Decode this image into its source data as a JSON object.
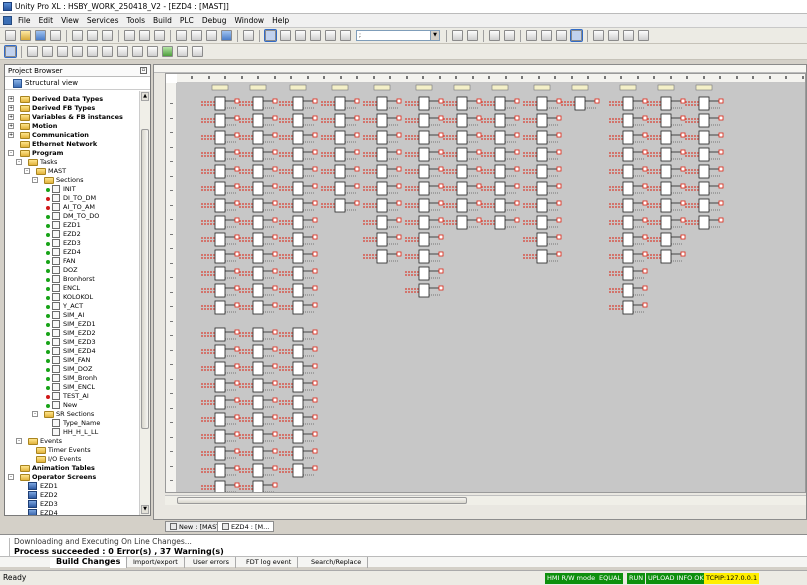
{
  "window": {
    "title": "Unity Pro XL : HSBY_WORK_250418_V2 - [EZD4 : [MAST]]"
  },
  "menu": [
    "File",
    "Edit",
    "View",
    "Services",
    "Tools",
    "Build",
    "PLC",
    "Debug",
    "Window",
    "Help"
  ],
  "toolbar": {
    "combo_value": ";"
  },
  "project_browser": {
    "title": "Project Browser",
    "view_label": "Structural view",
    "items": [
      {
        "label": "Derived Data Types",
        "level": 1,
        "kind": "folder",
        "bold": true,
        "exp": "+"
      },
      {
        "label": "Derived FB Types",
        "level": 1,
        "kind": "folder",
        "bold": true,
        "exp": "+"
      },
      {
        "label": "Variables & FB instances",
        "level": 1,
        "kind": "folder",
        "bold": true,
        "exp": "+"
      },
      {
        "label": "Motion",
        "level": 1,
        "kind": "folder",
        "bold": true,
        "exp": "+"
      },
      {
        "label": "Communication",
        "level": 1,
        "kind": "folder",
        "bold": true,
        "exp": "+"
      },
      {
        "label": "Ethernet Network",
        "level": 1,
        "kind": "folder",
        "bold": true,
        "exp": ""
      },
      {
        "label": "Program",
        "level": 1,
        "kind": "folder",
        "bold": true,
        "exp": "-"
      },
      {
        "label": "Tasks",
        "level": 2,
        "kind": "folder",
        "bold": false,
        "exp": "-"
      },
      {
        "label": "MAST",
        "level": 3,
        "kind": "folder",
        "bold": false,
        "exp": "-"
      },
      {
        "label": "Sections",
        "level": 4,
        "kind": "folder",
        "bold": false,
        "exp": "-"
      },
      {
        "label": "INIT",
        "level": 5,
        "kind": "section",
        "status": "green"
      },
      {
        "label": "DI_TO_DM",
        "level": 5,
        "kind": "section",
        "status": "red"
      },
      {
        "label": "AI_TO_AM",
        "level": 5,
        "kind": "section",
        "status": "red"
      },
      {
        "label": "DM_TO_DO",
        "level": 5,
        "kind": "section",
        "status": "green"
      },
      {
        "label": "EZD1",
        "level": 5,
        "kind": "section",
        "status": "green"
      },
      {
        "label": "EZD2",
        "level": 5,
        "kind": "section",
        "status": "green"
      },
      {
        "label": "EZD3",
        "level": 5,
        "kind": "section",
        "status": "green"
      },
      {
        "label": "EZD4",
        "level": 5,
        "kind": "section",
        "status": "green"
      },
      {
        "label": "FAN",
        "level": 5,
        "kind": "section",
        "status": "green"
      },
      {
        "label": "DOZ",
        "level": 5,
        "kind": "section",
        "status": "green"
      },
      {
        "label": "Bronhorst",
        "level": 5,
        "kind": "section",
        "status": "green"
      },
      {
        "label": "ENCL",
        "level": 5,
        "kind": "section",
        "status": "green"
      },
      {
        "label": "KOLOKOL",
        "level": 5,
        "kind": "section",
        "status": "green"
      },
      {
        "label": "Y_ACT",
        "level": 5,
        "kind": "section",
        "status": "green"
      },
      {
        "label": "SIM_AI",
        "level": 5,
        "kind": "section",
        "status": "green"
      },
      {
        "label": "SIM_EZD1",
        "level": 5,
        "kind": "section",
        "status": "green"
      },
      {
        "label": "SIM_EZD2",
        "level": 5,
        "kind": "section",
        "status": "green"
      },
      {
        "label": "SIM_EZD3",
        "level": 5,
        "kind": "section",
        "status": "green"
      },
      {
        "label": "SIM_EZD4",
        "level": 5,
        "kind": "section",
        "status": "green"
      },
      {
        "label": "SIM_FAN",
        "level": 5,
        "kind": "section",
        "status": "green"
      },
      {
        "label": "SIM_DOZ",
        "level": 5,
        "kind": "section",
        "status": "green"
      },
      {
        "label": "SIM_Bronh",
        "level": 5,
        "kind": "section",
        "status": "green"
      },
      {
        "label": "SIM_ENCL",
        "level": 5,
        "kind": "section",
        "status": "green"
      },
      {
        "label": "TEST_AI",
        "level": 5,
        "kind": "section",
        "status": "red"
      },
      {
        "label": "New",
        "level": 5,
        "kind": "section",
        "status": "green"
      },
      {
        "label": "SR Sections",
        "level": 4,
        "kind": "folder",
        "bold": false,
        "exp": "-"
      },
      {
        "label": "Type_Name",
        "level": 5,
        "kind": "section",
        "status": ""
      },
      {
        "label": "HH_H_L_LL",
        "level": 5,
        "kind": "section",
        "status": ""
      },
      {
        "label": "Events",
        "level": 2,
        "kind": "folder",
        "bold": false,
        "exp": "-"
      },
      {
        "label": "Timer Events",
        "level": 3,
        "kind": "folder",
        "bold": false,
        "exp": ""
      },
      {
        "label": "I/O Events",
        "level": 3,
        "kind": "folder",
        "bold": false,
        "exp": ""
      },
      {
        "label": "Animation Tables",
        "level": 1,
        "kind": "folder",
        "bold": true,
        "exp": ""
      },
      {
        "label": "Operator Screens",
        "level": 1,
        "kind": "folder",
        "bold": true,
        "exp": "-"
      },
      {
        "label": "EZD1",
        "level": 2,
        "kind": "screen"
      },
      {
        "label": "EZD2",
        "level": 2,
        "kind": "screen"
      },
      {
        "label": "EZD3",
        "level": 2,
        "kind": "screen"
      },
      {
        "label": "EZD4",
        "level": 2,
        "kind": "screen"
      }
    ]
  },
  "editor": {
    "columns": 13,
    "blocks_per_column": [
      21,
      21,
      21,
      7,
      10,
      12,
      8,
      8,
      10,
      1,
      13,
      10,
      8
    ],
    "lower_blocks_per_column": [
      11,
      11,
      9
    ]
  },
  "editor_tabs": [
    "New : [MAST]",
    "EZD4 : [M..."
  ],
  "output": {
    "line1": "Downloading and Executing On Line Changes...",
    "line2": "Process succeeded : 0 Error(s) , 37 Warning(s)",
    "tabs": [
      "Build Changes",
      "Import/export",
      "User errors",
      "FDT log event",
      "Search/Replace"
    ]
  },
  "status": {
    "ready": "Ready",
    "badges": [
      "HMI R/W mode",
      "EQUAL",
      "RUN",
      "UPLOAD INFO OK",
      "TCPIP:127.0.0.1"
    ],
    "colors": {
      "green": "#0d8f0d",
      "yellow": "#ffef00"
    }
  }
}
